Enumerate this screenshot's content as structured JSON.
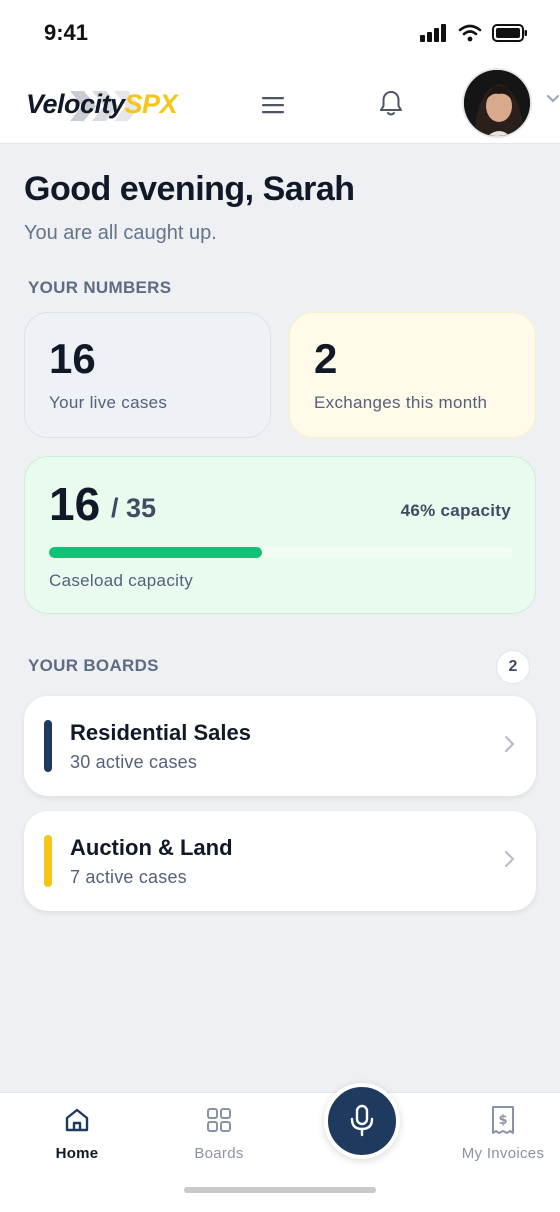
{
  "status_bar": {
    "time": "9:41"
  },
  "header": {
    "logo_part1": "Velocity",
    "logo_part2": "SPX",
    "logo_colors": {
      "primary": "#111827",
      "accent": "#f5c518"
    },
    "menu_icon": "hamburger-icon",
    "notifications_icon": "bell-icon",
    "avatar_icon": "user-avatar"
  },
  "greeting": {
    "title": "Good evening, Sarah",
    "subtitle": "You are all caught up."
  },
  "numbers": {
    "section_label": "YOUR NUMBERS",
    "live_cases": {
      "value": "16",
      "label": "Your live cases"
    },
    "exchanges": {
      "value": "2",
      "label": "Exchanges this month"
    },
    "capacity": {
      "current": "16",
      "total": "/ 35",
      "percent_text": "46% capacity",
      "fraction": 0.46,
      "label": "Caseload capacity",
      "bar_color": "#10c276"
    }
  },
  "boards": {
    "section_label": "YOUR BOARDS",
    "count": "2",
    "items": [
      {
        "title": "Residential Sales",
        "subtitle": "30 active cases",
        "color": "#1f3a5f"
      },
      {
        "title": "Auction & Land",
        "subtitle": "7 active cases",
        "color": "#f5c518"
      }
    ]
  },
  "tab_bar": {
    "home": "Home",
    "boards": "Boards",
    "invoices": "My Invoices",
    "mic_icon": "microphone-icon"
  }
}
